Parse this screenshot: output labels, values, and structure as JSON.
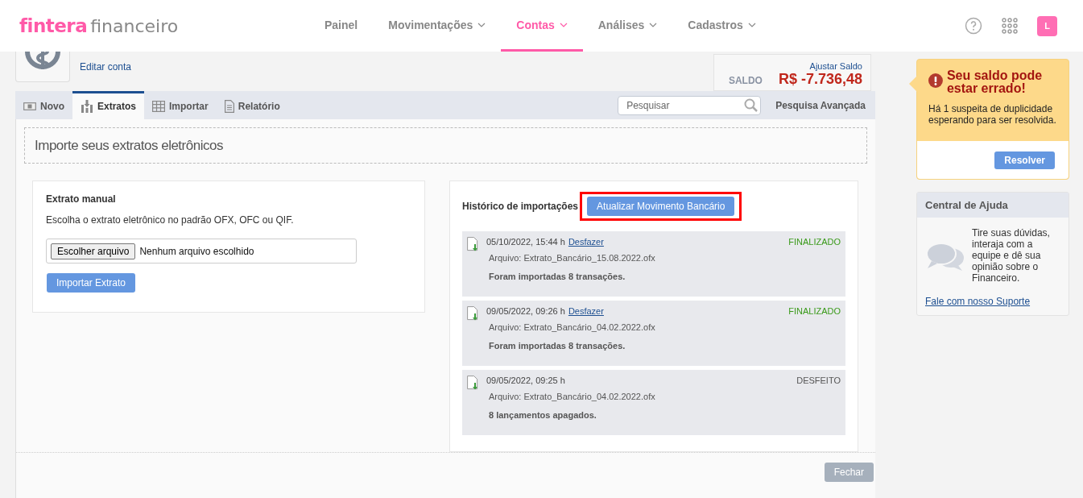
{
  "brand": {
    "name": "fintera",
    "product": "financeiro"
  },
  "nav": [
    {
      "label": "Painel",
      "selected": false,
      "dropdown": false
    },
    {
      "label": "Movimentações",
      "selected": false,
      "dropdown": true
    },
    {
      "label": "Contas",
      "selected": true,
      "dropdown": true
    },
    {
      "label": "Análises",
      "selected": false,
      "dropdown": true
    },
    {
      "label": "Cadastros",
      "selected": false,
      "dropdown": true
    }
  ],
  "avatar": "L",
  "account": {
    "edit_link": "Editar conta",
    "adjust_link": "Ajustar Saldo",
    "balance_label": "SALDO",
    "balance": "R$ -7.736,48"
  },
  "tabs": [
    {
      "label": "Novo",
      "selected": false
    },
    {
      "label": "Extratos",
      "selected": true
    },
    {
      "label": "Importar",
      "selected": false
    },
    {
      "label": "Relatório",
      "selected": false
    }
  ],
  "search": {
    "placeholder": "Pesquisar"
  },
  "advanced_search": "Pesquisa Avançada",
  "section_title": "Importe seus extratos eletrônicos",
  "manual": {
    "title": "Extrato manual",
    "description": "Escolha o extrato eletrônico no padrão OFX, OFC ou QIF.",
    "file_button": "Escolher arquivo",
    "file_status": "Nenhum arquivo escolhido",
    "import_button": "Importar Extrato"
  },
  "history": {
    "title": "Histórico de importações",
    "update_button": "Atualizar Movimento Bancário",
    "highlighted": true,
    "items": [
      {
        "datetime": "05/10/2022, 15:44 h",
        "undo_link": "Desfazer",
        "status": "FINALIZADO",
        "kind": "done",
        "file": "Arquivo: Extrato_Bancário_15.08.2022.ofx",
        "message": "Foram importadas 8 transações."
      },
      {
        "datetime": "09/05/2022, 09:26 h",
        "undo_link": "Desfazer",
        "status": "FINALIZADO",
        "kind": "done",
        "file": "Arquivo: Extrato_Bancário_04.02.2022.ofx",
        "message": "Foram importadas 8 transações."
      },
      {
        "datetime": "09/05/2022, 09:25 h",
        "status": "DESFEITO",
        "kind": "undone",
        "file": "Arquivo: Extrato_Bancário_04.02.2022.ofx",
        "message": "8 lançamentos apagados."
      }
    ]
  },
  "close_button": "Fechar",
  "alert": {
    "title": "Seu saldo pode estar errado!",
    "text": "Há 1 suspeita de duplicidade esperando para ser resolvida.",
    "button": "Resolver"
  },
  "help": {
    "title": "Central de Ajuda",
    "text": "Tire suas dúvidas, interaja com a equipe e dê sua opinião sobre o Financeiro.",
    "link": "Fale com nosso Suporte"
  }
}
